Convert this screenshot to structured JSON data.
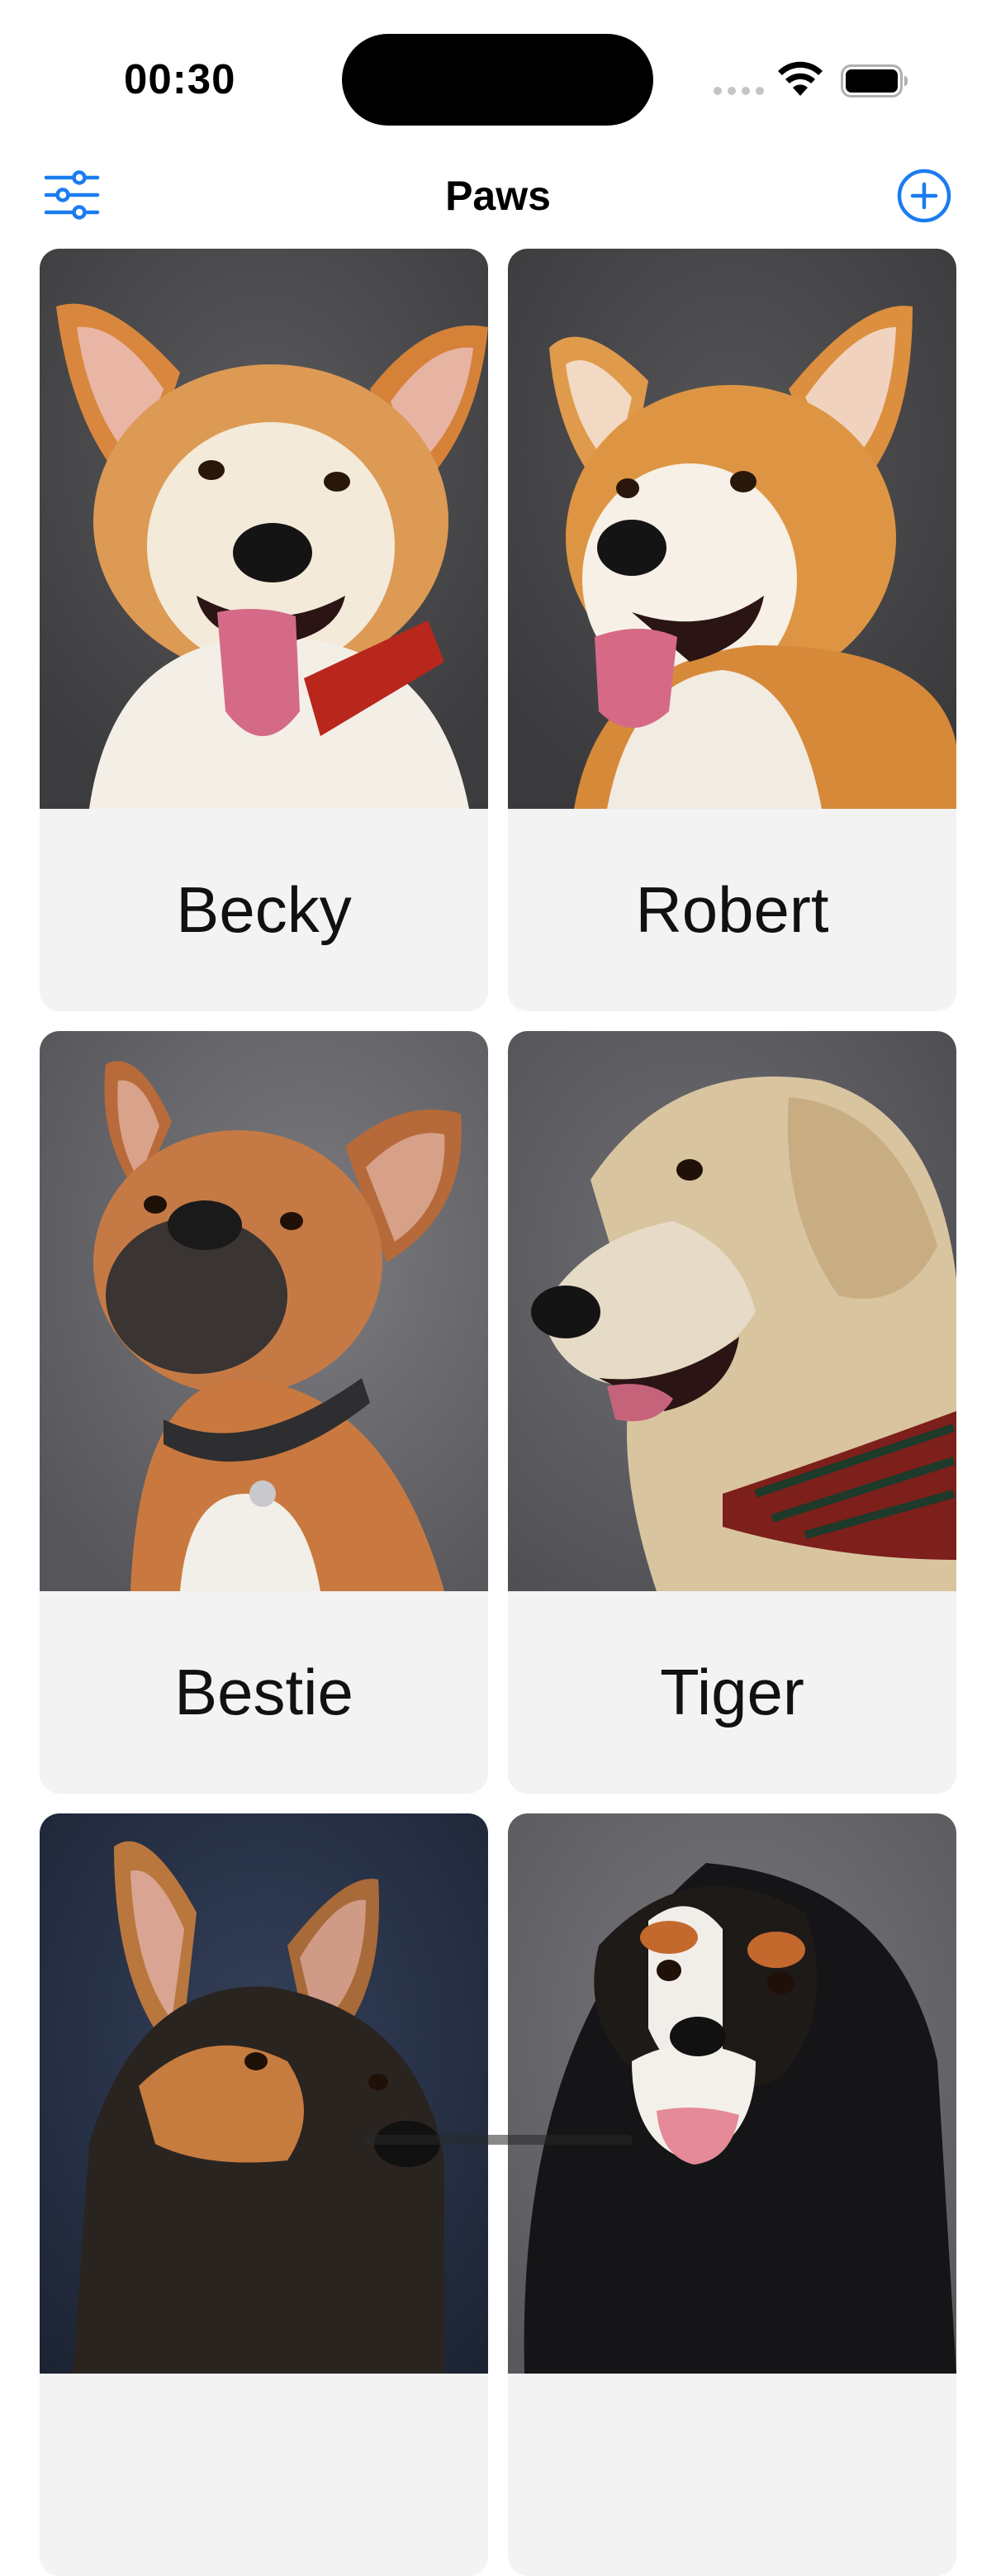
{
  "status_bar": {
    "time": "00:30"
  },
  "nav": {
    "title": "Paws",
    "filter_icon": "sliders-icon",
    "add_icon": "plus-circle-icon",
    "accent_color": "#1b7cf0"
  },
  "pets": [
    {
      "name": "Becky",
      "photo": "corgi-photo",
      "bg": "#4c4c4e"
    },
    {
      "name": "Robert",
      "photo": "corgi-photo",
      "bg": "#47484a"
    },
    {
      "name": "Bestie",
      "photo": "french-bulldog-photo",
      "bg": "#6c6c70"
    },
    {
      "name": "Tiger",
      "photo": "golden-retriever-photo",
      "bg": "#606064"
    },
    {
      "name": "",
      "photo": "german-shepherd-photo",
      "bg": "#263042"
    },
    {
      "name": "",
      "photo": "cavalier-king-charles-photo",
      "bg": "#6a6a6e"
    }
  ]
}
